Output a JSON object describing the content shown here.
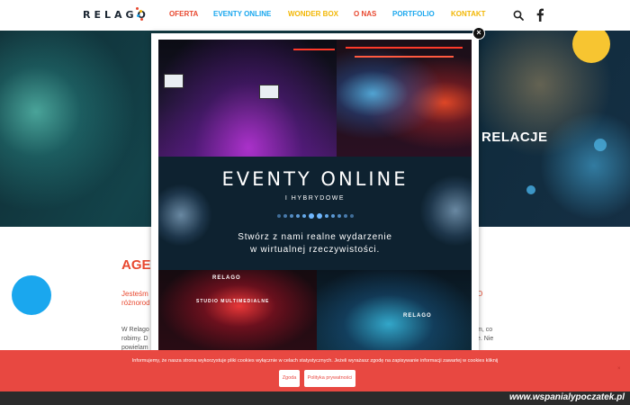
{
  "header": {
    "logo": "RELAGO",
    "nav": [
      {
        "label": "OFERTA",
        "color": "#e8482f"
      },
      {
        "label": "EVENTY ONLINE",
        "color": "#1aa7ee"
      },
      {
        "label": "WONDER BOX",
        "color": "#f2b705"
      },
      {
        "label": "O NAS",
        "color": "#e8482f"
      },
      {
        "label": "PORTFOLIO",
        "color": "#1aa7ee"
      },
      {
        "label": "KONTAKT",
        "color": "#f2b705"
      }
    ]
  },
  "hero": {
    "heading": "RELACJE"
  },
  "content": {
    "title": "AGE",
    "intro_line1": "Jesteśm",
    "intro_line2": "różnorod",
    "intro_right": "O",
    "para_line1": "W Relago",
    "para_line2": "robimy. D",
    "para_line3": "powielam",
    "para_right_line1": "m, co",
    "para_right_line2": "e. Nie"
  },
  "popup": {
    "title": "EVENTY ONLINE",
    "subtitle": "I HYBRYDOWE",
    "text_line1": "Stwórz z nami realne wydarzenie",
    "text_line2": "w wirtualnej rzeczywistości.",
    "stage_label_left": "RELAGO",
    "stage_label_left_sub": "STUDIO MULTIMEDIALNE",
    "stage_label_right": "RELAGO",
    "close": "×"
  },
  "cookie": {
    "text": "Informujemy, że nasza strona wykorzystuje pliki cookies wyłącznie w celach statystycznych. Jeżeli wyrażasz zgodę na zapisywanie informacji zawartej w cookies kliknij",
    "agree_label": "Zgoda",
    "policy_label": "Polityka prywatności"
  },
  "watermark": "www.wspanialypoczatek.pl",
  "colors": {
    "accent_red": "#e8482f",
    "accent_blue": "#1aa7ee",
    "accent_yellow": "#f2b705"
  }
}
